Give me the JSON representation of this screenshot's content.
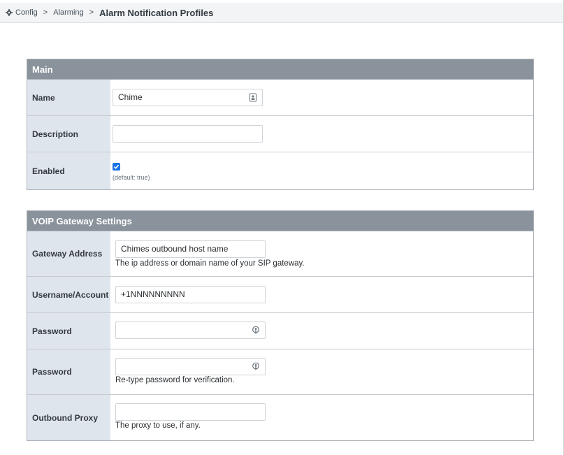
{
  "breadcrumb": {
    "icon": "gear-icon",
    "items": [
      "Config",
      "Alarming"
    ],
    "current": "Alarm Notification Profiles",
    "separator": ">"
  },
  "main": {
    "title": "Main",
    "name_label": "Name",
    "name_value": "Chime",
    "description_label": "Description",
    "description_value": "",
    "enabled_label": "Enabled",
    "enabled_checked": true,
    "enabled_default": "(default: true)"
  },
  "voip": {
    "title": "VOIP Gateway Settings",
    "gateway_label": "Gateway Address",
    "gateway_value": "Chimes outbound host name",
    "gateway_help": "The ip address or domain name of your SIP gateway.",
    "username_label": "Username/Account",
    "username_value": "+1NNNNNNNNN",
    "password_label": "Password",
    "password_value": "",
    "password2_label": "Password",
    "password2_value": "",
    "password2_help": "Re-type password for verification.",
    "proxy_label": "Outbound Proxy",
    "proxy_value": "",
    "proxy_help": "The proxy to use, if any."
  }
}
